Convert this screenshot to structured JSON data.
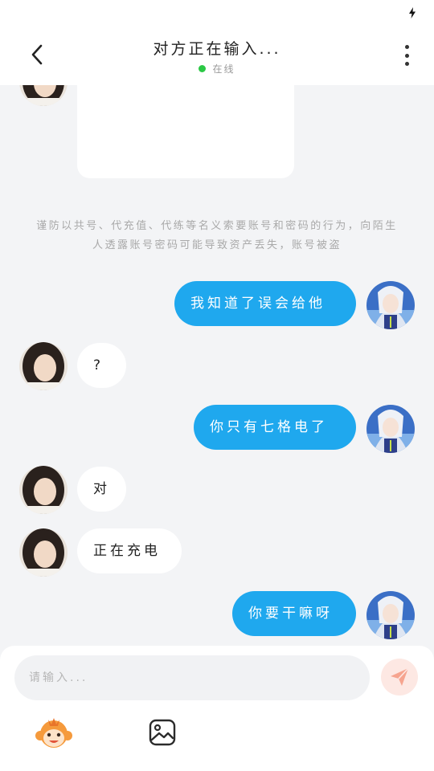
{
  "header": {
    "title": "对方正在输入...",
    "status": "在线",
    "online_color": "#2bc845"
  },
  "icons": {
    "status_bar": "charging-bolt-icon",
    "back": "chevron-left-icon",
    "more": "more-vertical-icon",
    "send": "paper-plane-icon",
    "emoji": "monkey-emoji-icon",
    "image": "image-icon"
  },
  "chat": {
    "notice": "谨防以共号、代充值、代练等名义索要账号和密码的行为，向陌生人透露账号密码可能导致资产丢失，账号被盗",
    "messages": [
      {
        "direction": "outgoing",
        "text": "我知道了误会给他"
      },
      {
        "direction": "incoming",
        "text": "?"
      },
      {
        "direction": "outgoing",
        "text": "你只有七格电了"
      },
      {
        "direction": "incoming",
        "text": "对"
      },
      {
        "direction": "incoming",
        "text": "正在充电"
      },
      {
        "direction": "outgoing",
        "text": "你要干嘛呀"
      }
    ]
  },
  "composer": {
    "placeholder": "请输入..."
  },
  "colors": {
    "outgoing_bubble": "#1fa8ee",
    "incoming_bubble": "#ffffff",
    "background": "#f3f4f6",
    "send_button": "#fde8e3",
    "send_icon": "#f6a48f"
  }
}
